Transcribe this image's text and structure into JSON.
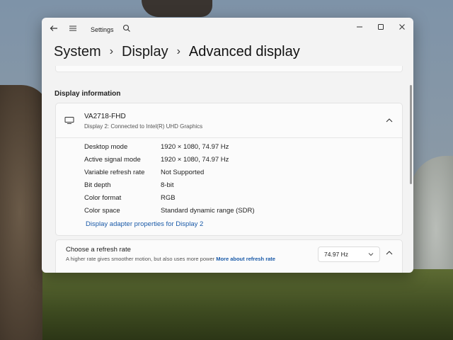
{
  "window": {
    "app_title": "Settings",
    "breadcrumb": [
      "System",
      "Display",
      "Advanced display"
    ]
  },
  "section": {
    "title": "Display information"
  },
  "display": {
    "name": "VA2718-FHD",
    "subtitle": "Display 2: Connected to Intel(R) UHD Graphics",
    "rows": [
      {
        "key": "Desktop mode",
        "value": "1920 × 1080, 74.97 Hz"
      },
      {
        "key": "Active signal mode",
        "value": "1920 × 1080, 74.97 Hz"
      },
      {
        "key": "Variable refresh rate",
        "value": "Not Supported"
      },
      {
        "key": "Bit depth",
        "value": "8-bit"
      },
      {
        "key": "Color format",
        "value": "RGB"
      },
      {
        "key": "Color space",
        "value": "Standard dynamic range (SDR)"
      }
    ],
    "adapter_link": "Display adapter properties for Display 2"
  },
  "refresh": {
    "title": "Choose a refresh rate",
    "description": "A higher rate gives smoother motion, but also uses more power",
    "more_link": "More about refresh rate",
    "selected": "74.97 Hz"
  },
  "icons": [
    "back-arrow-icon",
    "hamburger-menu-icon",
    "search-icon",
    "minimize-icon",
    "maximize-icon",
    "close-icon",
    "monitor-icon",
    "chevron-up-icon",
    "chevron-down-icon"
  ]
}
